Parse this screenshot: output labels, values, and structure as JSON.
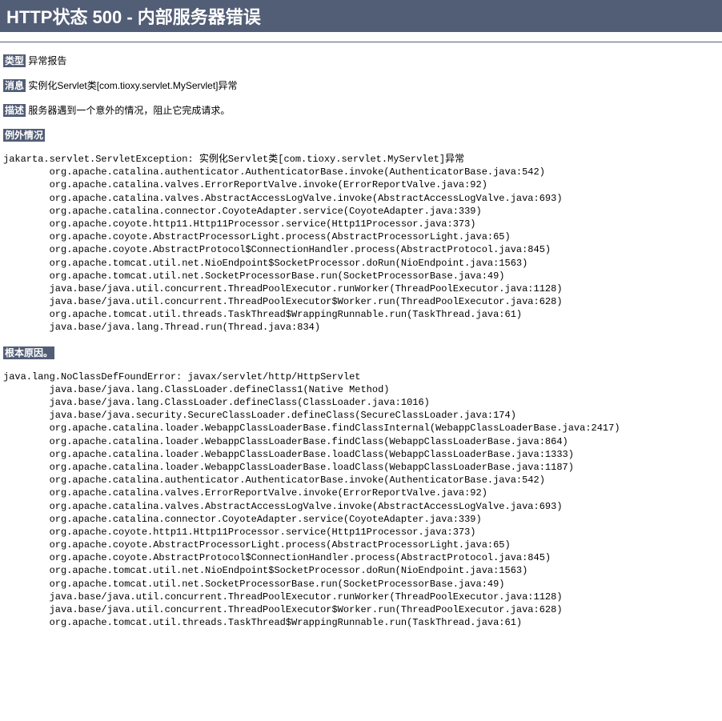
{
  "title": "HTTP状态 500 - 内部服务器错误",
  "type_label": "类型",
  "type_value": "异常报告",
  "message_label": "消息",
  "message_value": "实例化Servlet类[com.tioxy.servlet.MyServlet]异常",
  "description_label": "描述",
  "description_value": "服务器遇到一个意外的情况，阻止它完成请求。",
  "exception_label": "例外情况",
  "exception_stack": "jakarta.servlet.ServletException: 实例化Servlet类[com.tioxy.servlet.MyServlet]异常\n\torg.apache.catalina.authenticator.AuthenticatorBase.invoke(AuthenticatorBase.java:542)\n\torg.apache.catalina.valves.ErrorReportValve.invoke(ErrorReportValve.java:92)\n\torg.apache.catalina.valves.AbstractAccessLogValve.invoke(AbstractAccessLogValve.java:693)\n\torg.apache.catalina.connector.CoyoteAdapter.service(CoyoteAdapter.java:339)\n\torg.apache.coyote.http11.Http11Processor.service(Http11Processor.java:373)\n\torg.apache.coyote.AbstractProcessorLight.process(AbstractProcessorLight.java:65)\n\torg.apache.coyote.AbstractProtocol$ConnectionHandler.process(AbstractProtocol.java:845)\n\torg.apache.tomcat.util.net.NioEndpoint$SocketProcessor.doRun(NioEndpoint.java:1563)\n\torg.apache.tomcat.util.net.SocketProcessorBase.run(SocketProcessorBase.java:49)\n\tjava.base/java.util.concurrent.ThreadPoolExecutor.runWorker(ThreadPoolExecutor.java:1128)\n\tjava.base/java.util.concurrent.ThreadPoolExecutor$Worker.run(ThreadPoolExecutor.java:628)\n\torg.apache.tomcat.util.threads.TaskThread$WrappingRunnable.run(TaskThread.java:61)\n\tjava.base/java.lang.Thread.run(Thread.java:834)",
  "root_cause_label": "根本原因。",
  "root_cause_stack": "java.lang.NoClassDefFoundError: javax/servlet/http/HttpServlet\n\tjava.base/java.lang.ClassLoader.defineClass1(Native Method)\n\tjava.base/java.lang.ClassLoader.defineClass(ClassLoader.java:1016)\n\tjava.base/java.security.SecureClassLoader.defineClass(SecureClassLoader.java:174)\n\torg.apache.catalina.loader.WebappClassLoaderBase.findClassInternal(WebappClassLoaderBase.java:2417)\n\torg.apache.catalina.loader.WebappClassLoaderBase.findClass(WebappClassLoaderBase.java:864)\n\torg.apache.catalina.loader.WebappClassLoaderBase.loadClass(WebappClassLoaderBase.java:1333)\n\torg.apache.catalina.loader.WebappClassLoaderBase.loadClass(WebappClassLoaderBase.java:1187)\n\torg.apache.catalina.authenticator.AuthenticatorBase.invoke(AuthenticatorBase.java:542)\n\torg.apache.catalina.valves.ErrorReportValve.invoke(ErrorReportValve.java:92)\n\torg.apache.catalina.valves.AbstractAccessLogValve.invoke(AbstractAccessLogValve.java:693)\n\torg.apache.catalina.connector.CoyoteAdapter.service(CoyoteAdapter.java:339)\n\torg.apache.coyote.http11.Http11Processor.service(Http11Processor.java:373)\n\torg.apache.coyote.AbstractProcessorLight.process(AbstractProcessorLight.java:65)\n\torg.apache.coyote.AbstractProtocol$ConnectionHandler.process(AbstractProtocol.java:845)\n\torg.apache.tomcat.util.net.NioEndpoint$SocketProcessor.doRun(NioEndpoint.java:1563)\n\torg.apache.tomcat.util.net.SocketProcessorBase.run(SocketProcessorBase.java:49)\n\tjava.base/java.util.concurrent.ThreadPoolExecutor.runWorker(ThreadPoolExecutor.java:1128)\n\tjava.base/java.util.concurrent.ThreadPoolExecutor$Worker.run(ThreadPoolExecutor.java:628)\n\torg.apache.tomcat.util.threads.TaskThread$WrappingRunnable.run(TaskThread.java:61)"
}
